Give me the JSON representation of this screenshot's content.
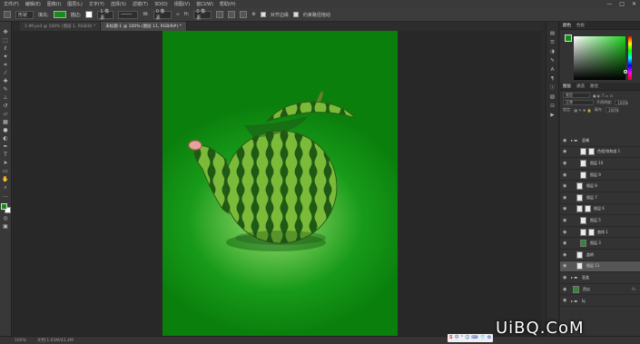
{
  "menubar": {
    "items": [
      "文件(F)",
      "编辑(E)",
      "图像(I)",
      "图层(L)",
      "文字(Y)",
      "选择(S)",
      "滤镜(T)",
      "3D(D)",
      "视图(V)",
      "窗口(W)",
      "帮助(H)"
    ],
    "window_controls": [
      "—",
      "□",
      "✕"
    ]
  },
  "options": {
    "mode_value": "形状",
    "fill_label": "填充:",
    "stroke_label": "描边:",
    "stroke_width": "1 像素",
    "w_label": "W:",
    "w_value": "0 像素",
    "h_label": "H:",
    "h_value": "0 像素",
    "align_edges_label": "对齐边缘",
    "constrain_label": "约束路径拖动"
  },
  "tabs": [
    {
      "label": "1-IM.psd @ 100% (图层 1, RGB/8) *",
      "active": false
    },
    {
      "label": "未标题-1 @ 100% (图层 11, RGB/8#) *",
      "active": true
    }
  ],
  "status": {
    "zoom": "100%",
    "doc_size": "文档:1.63M/43.4M"
  },
  "colors": {
    "foreground": "#148c14",
    "background": "#ffffff"
  },
  "panels": {
    "color_tabs": [
      "颜色",
      "色板"
    ],
    "layer_tabs": [
      "图层",
      "通道",
      "路径"
    ],
    "kind_filter": "类型",
    "blend_mode": "正常",
    "opacity_label": "不透明度:",
    "opacity_value": "100%",
    "lock_label": "锁定:",
    "fill_label": "填充:",
    "fill_value": "100%"
  },
  "layers": [
    {
      "name": "壶嘴",
      "indent": 0,
      "thumb": "white",
      "fx": ""
    },
    {
      "name": "色相/饱和度 1",
      "indent": 2,
      "thumb": "white",
      "fx": ""
    },
    {
      "name": "图层 10",
      "indent": 1,
      "thumb": "white",
      "fx": ""
    },
    {
      "name": "图层 9",
      "indent": 1,
      "thumb": "white",
      "fx": ""
    },
    {
      "name": "图层 8",
      "indent": 1,
      "thumb": "white",
      "fx": ""
    },
    {
      "name": "图层 7",
      "indent": 1,
      "thumb": "white",
      "fx": ""
    },
    {
      "name": "图层 6",
      "indent": 1,
      "thumb": "white",
      "fx": ""
    },
    {
      "name": "图层 5",
      "indent": 2,
      "thumb": "white",
      "fx": ""
    },
    {
      "name": "曲线 1",
      "indent": 2,
      "thumb": "white",
      "fx": ""
    },
    {
      "name": "图层 3",
      "indent": 2,
      "thumb": "green",
      "fx": ""
    },
    {
      "name": "盖柄",
      "indent": 1,
      "thumb": "white",
      "fx": ""
    },
    {
      "name": "图层 11",
      "indent": 1,
      "thumb": "white",
      "fx": "",
      "selected": true
    },
    {
      "name": "壶盖",
      "indent": 0,
      "thumb": "folder",
      "fx": ""
    },
    {
      "name": "西瓜",
      "indent": 0,
      "thumb": "green",
      "fx": "fx"
    },
    {
      "name": "bj",
      "indent": 0,
      "thumb": "folder",
      "fx": ""
    }
  ],
  "taskbar": {
    "ime": [
      "S",
      "中",
      "°",
      "☺",
      "⌨",
      "👕",
      "✿"
    ]
  },
  "watermark": "UiBQ.CoM"
}
